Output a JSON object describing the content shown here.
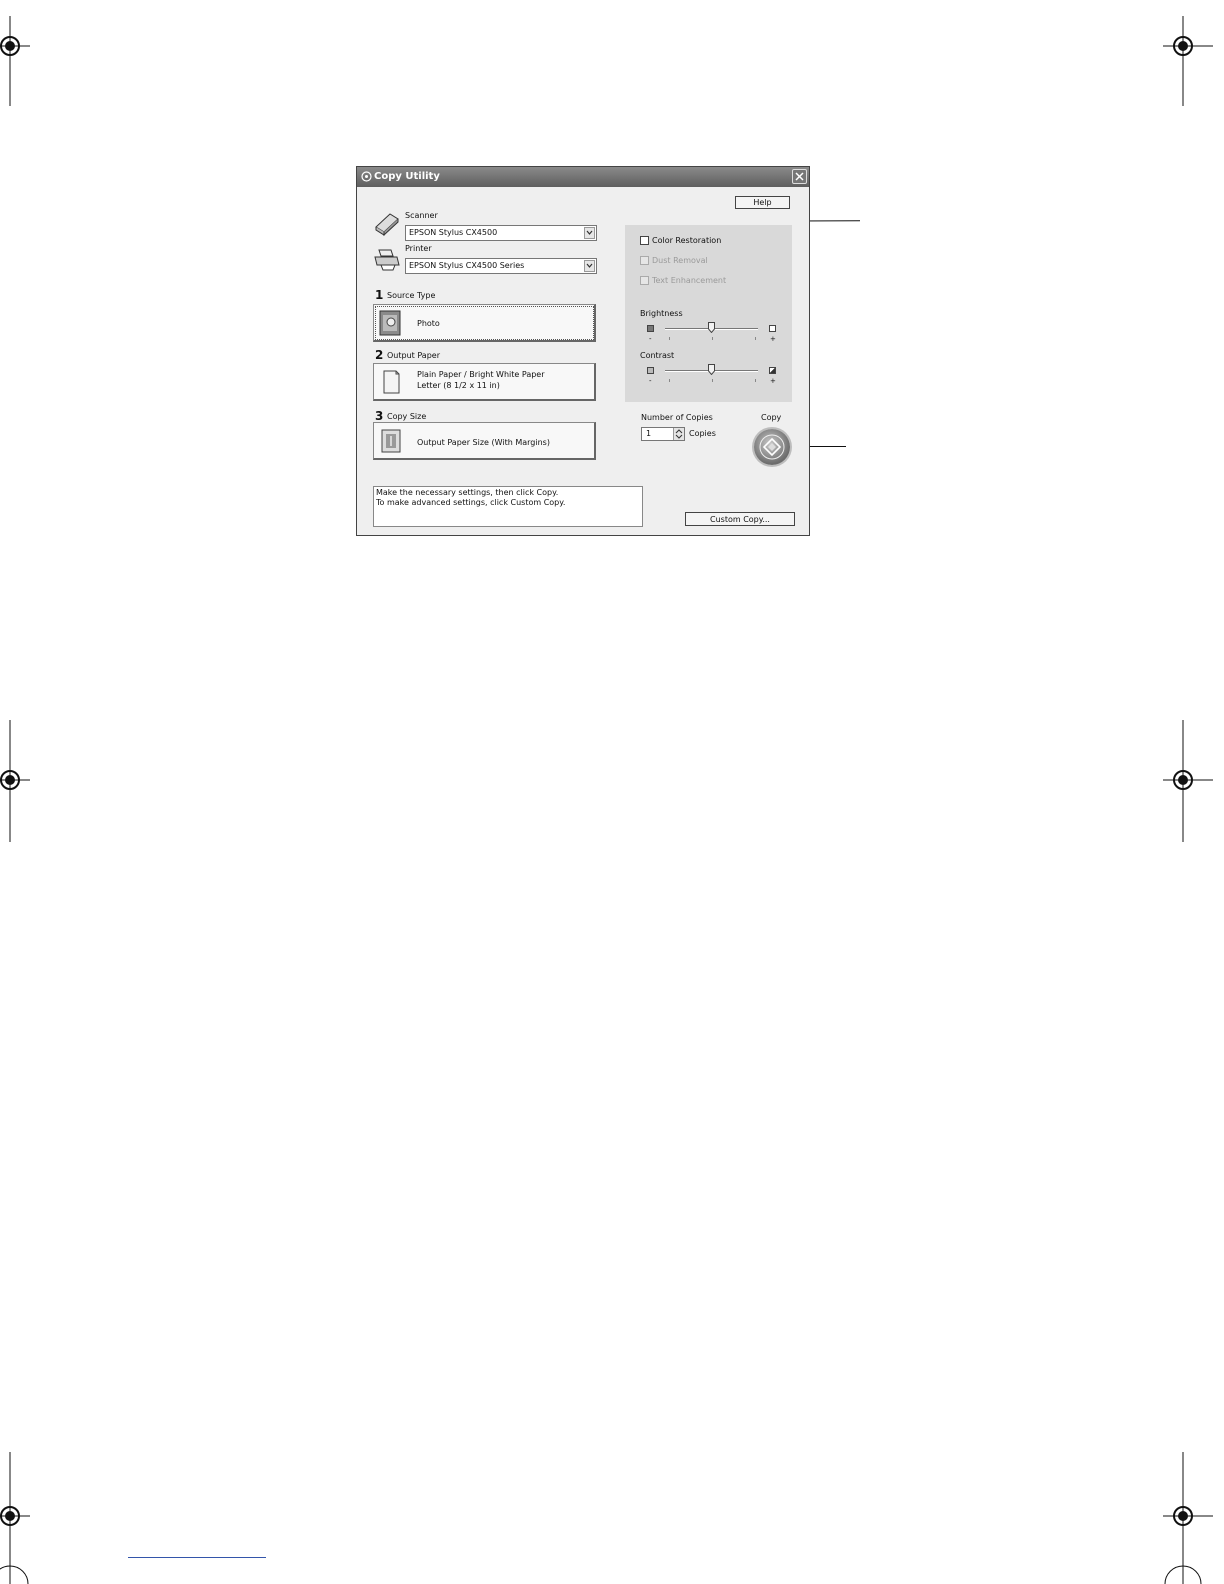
{
  "window": {
    "title": "Copy Utility",
    "help_label": "Help",
    "scanner": {
      "label": "Scanner",
      "value": "EPSON Stylus CX4500"
    },
    "printer": {
      "label": "Printer",
      "value": "EPSON Stylus CX4500 Series"
    },
    "steps": [
      {
        "number": "1",
        "label": "Source Type",
        "lines": [
          "Photo"
        ]
      },
      {
        "number": "2",
        "label": "Output Paper",
        "lines": [
          "Plain Paper / Bright White Paper",
          "Letter (8 1/2 x 11 in)"
        ]
      },
      {
        "number": "3",
        "label": "Copy Size",
        "lines": [
          "Output Paper Size (With Margins)"
        ]
      }
    ],
    "options": {
      "color_restoration": {
        "label": "Color Restoration",
        "checked": false,
        "enabled": true
      },
      "dust_removal": {
        "label": "Dust Removal",
        "checked": false,
        "enabled": false
      },
      "text_enhancement": {
        "label": "Text Enhancement",
        "checked": false,
        "enabled": false
      }
    },
    "brightness": {
      "label": "Brightness",
      "minus": "-",
      "plus": "+",
      "level": 0.5
    },
    "contrast": {
      "label": "Contrast",
      "minus": "-",
      "plus": "+",
      "level": 0.5
    },
    "copies": {
      "label": "Number of Copies",
      "value": "1",
      "unit": "Copies"
    },
    "copy_button_label": "Copy",
    "message": [
      "Make the necessary settings, then click Copy.",
      "To make advanced settings, click Custom Copy."
    ],
    "custom_copy_label": "Custom Copy..."
  }
}
